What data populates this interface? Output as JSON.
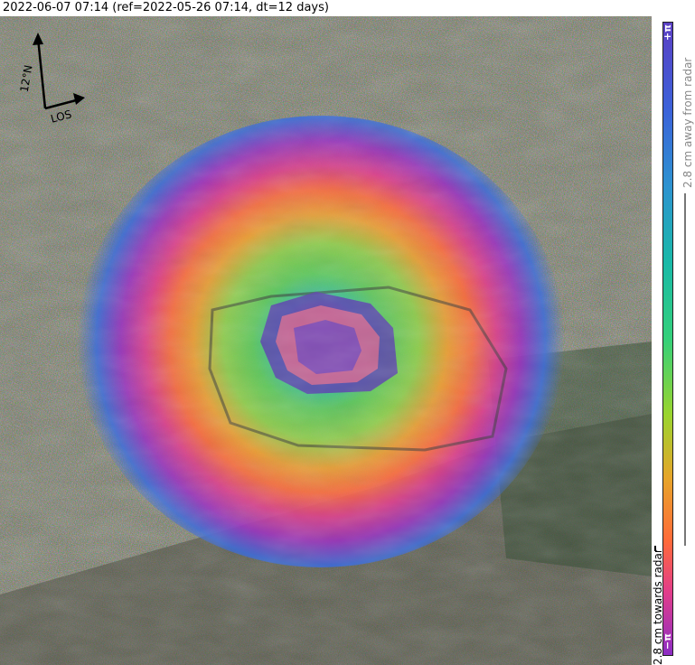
{
  "header": {
    "title": "2022-06-07 07:14 (ref=2022-05-26 07:14, dt=12 days)"
  },
  "compass": {
    "north_label": "12°N",
    "los_label": "LOS",
    "arrow_color": "#000000"
  },
  "colorbar": {
    "top_tick": "+π",
    "bottom_tick": "−π",
    "away_label": "2.8 cm away from radar",
    "towards_label": "2.8 cm towards radar",
    "colors": [
      "#5b3fc4",
      "#3b62d9",
      "#2d93d0",
      "#19b9a8",
      "#34d07a",
      "#9ad42e",
      "#e6a52a",
      "#ff6a3a",
      "#e23d8a",
      "#8c2dc4"
    ]
  }
}
